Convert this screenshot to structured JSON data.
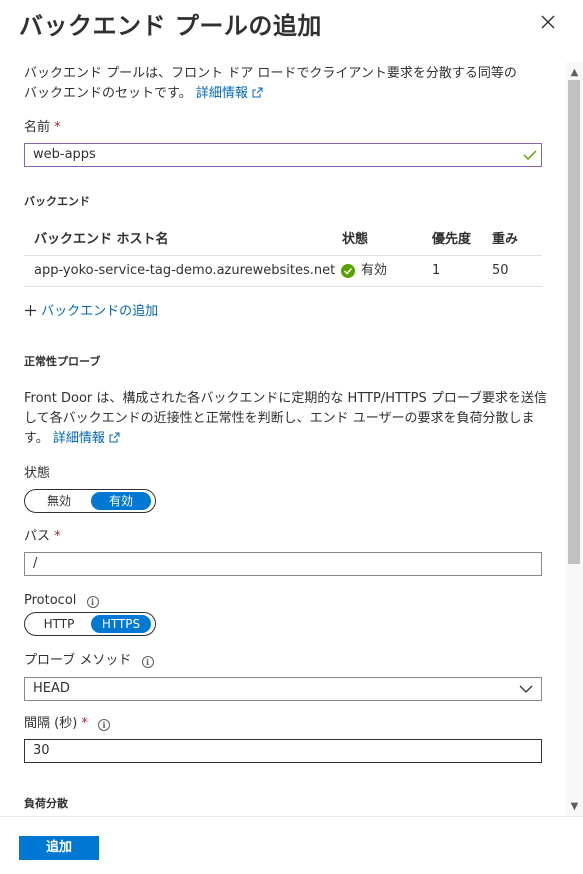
{
  "header": {
    "title": "バックエンド プールの追加"
  },
  "intro": {
    "line1": "バックエンド プールは、フロント ドア ロードでクライアント要求を分散する同等の",
    "line2": "バックエンドのセットです。",
    "link": "詳細情報"
  },
  "name_field": {
    "label": "名前",
    "required_mark": "*",
    "value": "web-apps"
  },
  "backends": {
    "section_title": "バックエンド",
    "columns": [
      "バックエンド ホスト名",
      "状態",
      "優先度",
      "重み"
    ],
    "rows": [
      {
        "host": "app-yoko-service-tag-demo.azurewebsites.net",
        "status": "有効",
        "priority": "1",
        "weight": "50"
      }
    ],
    "add_label": "バックエンドの追加"
  },
  "probe": {
    "section_title": "正常性プローブ",
    "desc_line1": "Front Door は、構成された各バックエンドに定期的な HTTP/HTTPS プローブ要求を送信",
    "desc_line2": "して各バックエンドの近接性と正常性を判断し、エンド ユーザーの要求を負荷分散しま",
    "desc_line3": "す。",
    "link": "詳細情報",
    "state_label": "状態",
    "state_options": [
      "無効",
      "有効"
    ],
    "state_selected": "有効",
    "path_label": "パス",
    "path_required": "*",
    "path_value": "/",
    "protocol_label": "Protocol",
    "protocol_options": [
      "HTTP",
      "HTTPS"
    ],
    "protocol_selected": "HTTPS",
    "method_label": "プローブ メソッド",
    "method_value": "HEAD",
    "interval_label": "間隔 (秒)",
    "interval_required": "*",
    "interval_value": "30"
  },
  "load_balancing": {
    "section_title": "負荷分散"
  },
  "footer": {
    "add_button": "追加"
  },
  "colors": {
    "accent": "#0078d4",
    "link": "#0067b8",
    "success": "#57a300",
    "required": "#a4262c",
    "valid_border": "#8764b8"
  }
}
